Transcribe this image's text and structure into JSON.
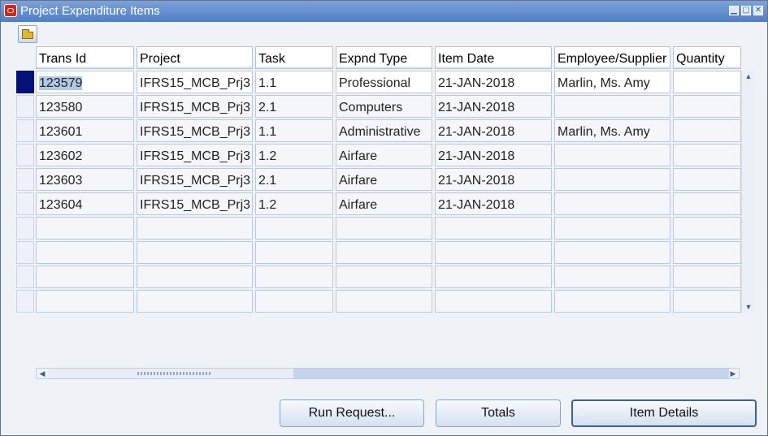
{
  "window": {
    "title": "Project Expenditure Items",
    "controls": [
      "minimize-icon",
      "maximize-icon",
      "close-icon"
    ]
  },
  "toolbar": {
    "open_folder_icon": "folder-open-icon"
  },
  "table": {
    "columns": [
      "Trans Id",
      "Project",
      "Task",
      "Expnd Type",
      "Item Date",
      "Employee/Supplier",
      "Quantity"
    ],
    "rows": [
      [
        "123579",
        "IFRS15_MCB_Prj3",
        "1.1",
        "Professional",
        "21-JAN-2018",
        "Marlin, Ms. Amy",
        ""
      ],
      [
        "123580",
        "IFRS15_MCB_Prj3",
        "2.1",
        "Computers",
        "21-JAN-2018",
        "",
        ""
      ],
      [
        "123601",
        "IFRS15_MCB_Prj3",
        "1.1",
        "Administrative",
        "21-JAN-2018",
        "Marlin, Ms. Amy",
        ""
      ],
      [
        "123602",
        "IFRS15_MCB_Prj3",
        "1.2",
        "Airfare",
        "21-JAN-2018",
        "",
        ""
      ],
      [
        "123603",
        "IFRS15_MCB_Prj3",
        "2.1",
        "Airfare",
        "21-JAN-2018",
        "",
        ""
      ],
      [
        "123604",
        "IFRS15_MCB_Prj3",
        "1.2",
        "Airfare",
        "21-JAN-2018",
        "",
        ""
      ],
      [
        "",
        "",
        "",
        "",
        "",
        "",
        ""
      ],
      [
        "",
        "",
        "",
        "",
        "",
        "",
        ""
      ],
      [
        "",
        "",
        "",
        "",
        "",
        "",
        ""
      ],
      [
        "",
        "",
        "",
        "",
        "",
        "",
        ""
      ]
    ]
  },
  "buttons": {
    "run_request": "Run Request...",
    "totals": "Totals",
    "item_details": "Item Details"
  },
  "colors": {
    "titlebar": "#4f7dc5",
    "current_record": "#061079",
    "selection": "#b3c8e9"
  }
}
